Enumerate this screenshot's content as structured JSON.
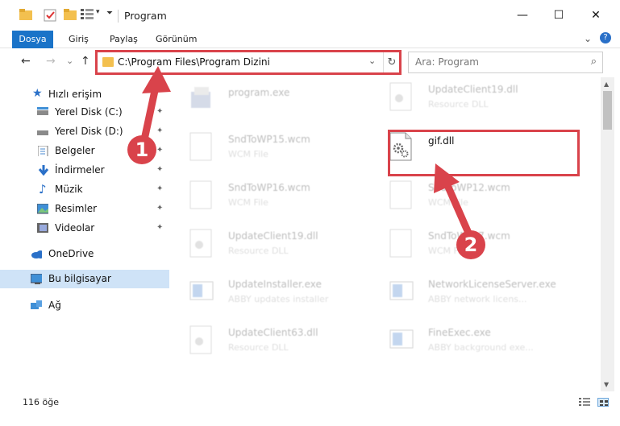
{
  "window": {
    "title": "Program",
    "minimize_glyph": "—",
    "maximize_glyph": "☐",
    "close_glyph": "✕"
  },
  "ribbon": {
    "tabs": [
      "Dosya",
      "Giriş",
      "Paylaş",
      "Görünüm"
    ],
    "collapse_glyph": "⌄",
    "help_glyph": "?"
  },
  "nav": {
    "back_glyph": "←",
    "forward_glyph": "→",
    "recent_glyph": "⌄",
    "up_glyph": "↑",
    "address": "C:\\Program Files\\Program Dizini",
    "address_dropdown_glyph": "⌄",
    "refresh_glyph": "↻",
    "search_placeholder": "Ara: Program",
    "search_glyph": "⌕"
  },
  "sidebar": {
    "quick_access": "Hızlı erişim",
    "items": [
      {
        "label": "Yerel Disk (C:)",
        "icon": "drive-icon"
      },
      {
        "label": "Yerel Disk (D:)",
        "icon": "drive-icon"
      },
      {
        "label": "Belgeler",
        "icon": "documents-icon"
      },
      {
        "label": "İndirmeler",
        "icon": "downloads-icon"
      },
      {
        "label": "Müzik",
        "icon": "music-icon"
      },
      {
        "label": "Resimler",
        "icon": "pictures-icon"
      },
      {
        "label": "Videolar",
        "icon": "videos-icon"
      }
    ],
    "onedrive": "OneDrive",
    "this_pc": "Bu bilgisayar",
    "network": "Ağ",
    "pin_glyph": "📌"
  },
  "files": [
    {
      "name": "program.exe",
      "type": "",
      "icon": "exe-icon",
      "faded": true
    },
    {
      "name": "UpdateClient19.dll",
      "type": "Resource DLL",
      "icon": "dll-icon",
      "faded": true
    },
    {
      "name": "SndToWP15.wcm",
      "type": "WCM File",
      "icon": "file-icon",
      "faded": true
    },
    {
      "name": "gif.dll",
      "type": "",
      "icon": "dll-gear-icon",
      "faded": false
    },
    {
      "name": "SndToWP16.wcm",
      "type": "WCM File",
      "icon": "file-icon",
      "faded": true
    },
    {
      "name": "SndToWP12.wcm",
      "type": "WCM File",
      "icon": "file-icon",
      "faded": true
    },
    {
      "name": "UpdateClient19.dll",
      "type": "Resource DLL",
      "icon": "dll-icon",
      "faded": true
    },
    {
      "name": "SndToWP17.wcm",
      "type": "WCM File",
      "icon": "file-icon",
      "faded": true
    },
    {
      "name": "UpdateInstaller.exe",
      "type": "ABBY updates installer",
      "icon": "app-icon",
      "faded": true
    },
    {
      "name": "NetworkLicenseServer.exe",
      "type": "ABBY network licens...",
      "icon": "app-icon",
      "faded": true
    },
    {
      "name": "UpdateClient63.dll",
      "type": "Resource DLL",
      "icon": "dll-icon",
      "faded": true
    },
    {
      "name": "FineExec.exe",
      "type": "ABBY background exe...",
      "icon": "app-icon",
      "faded": true
    }
  ],
  "markers": [
    "1",
    "2"
  ],
  "status": {
    "item_count": "116 öğe"
  },
  "colors": {
    "accent": "#1a73c8",
    "annotation_red": "#d9434b",
    "selected_bg": "#cfe3f7"
  }
}
